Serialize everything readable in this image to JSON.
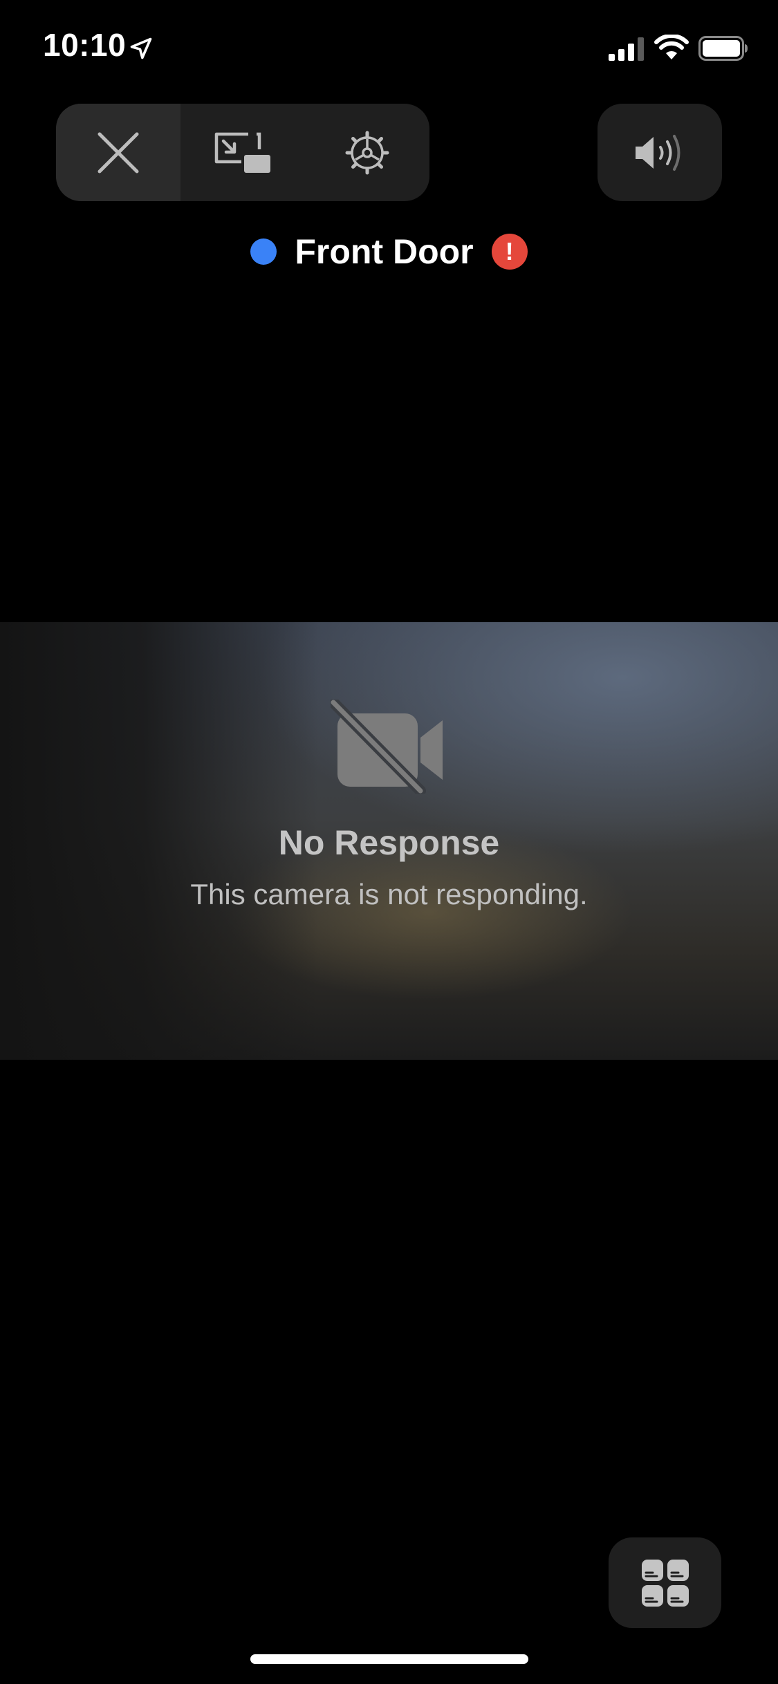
{
  "status_bar": {
    "time": "10:10",
    "icons": [
      "location-arrow-icon",
      "cellular-signal-icon",
      "wifi-icon",
      "battery-icon"
    ]
  },
  "toolbar": {
    "close_icon": "close-icon",
    "pip_icon": "picture-in-picture-icon",
    "settings_icon": "gear-icon",
    "volume_icon": "speaker-volume-icon"
  },
  "camera": {
    "name": "Front Door",
    "status_color": "#3a82f7",
    "alert_symbol": "!",
    "alert_color": "#e5473b"
  },
  "video": {
    "icon": "video-off-icon",
    "title": "No Response",
    "message": "This camera is not responding."
  },
  "bottom": {
    "grid_icon": "camera-grid-icon"
  }
}
